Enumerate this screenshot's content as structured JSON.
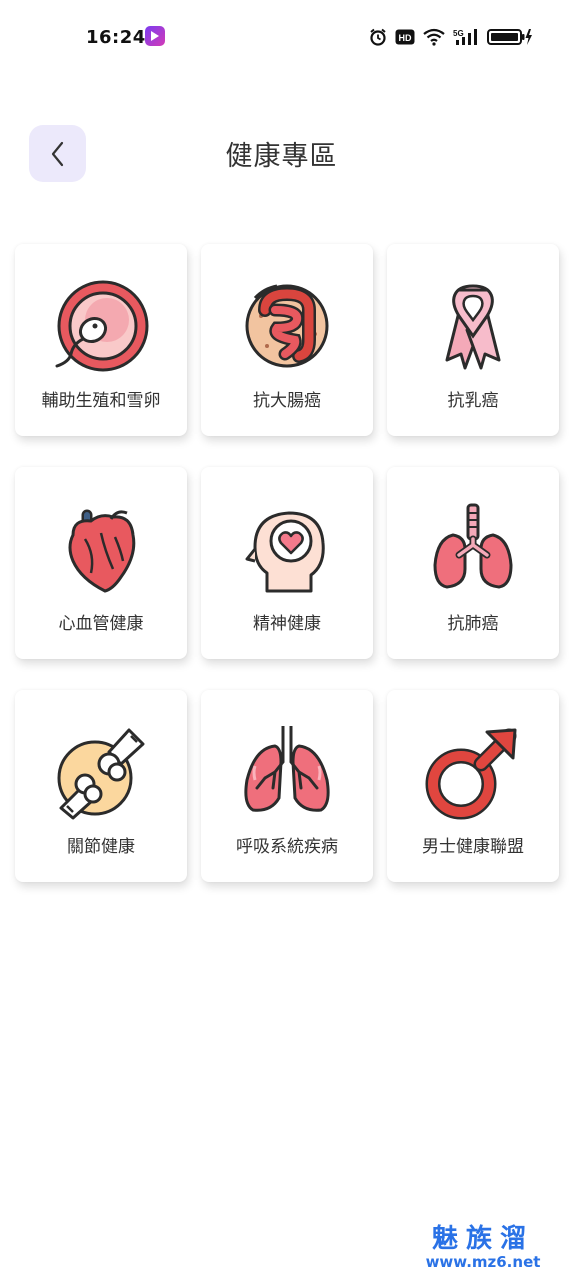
{
  "status_bar": {
    "time": "16:24",
    "hd_label": "HD",
    "network_label": "5G"
  },
  "header": {
    "title": "健康專區"
  },
  "categories": [
    {
      "label": "輔助生殖和雪卵",
      "icon": "egg-sperm-icon"
    },
    {
      "label": "抗大腸癌",
      "icon": "intestine-icon"
    },
    {
      "label": "抗乳癌",
      "icon": "pink-ribbon-icon"
    },
    {
      "label": "心血管健康",
      "icon": "heart-organ-icon"
    },
    {
      "label": "精神健康",
      "icon": "head-heart-icon"
    },
    {
      "label": "抗肺癌",
      "icon": "lungs-trachea-icon"
    },
    {
      "label": "關節健康",
      "icon": "knee-joint-icon"
    },
    {
      "label": "呼吸系統疾病",
      "icon": "lungs-icon"
    },
    {
      "label": "男士健康聯盟",
      "icon": "male-symbol-icon"
    }
  ],
  "watermark": {
    "title": "魅族溜",
    "url": "www.mz6.net"
  }
}
